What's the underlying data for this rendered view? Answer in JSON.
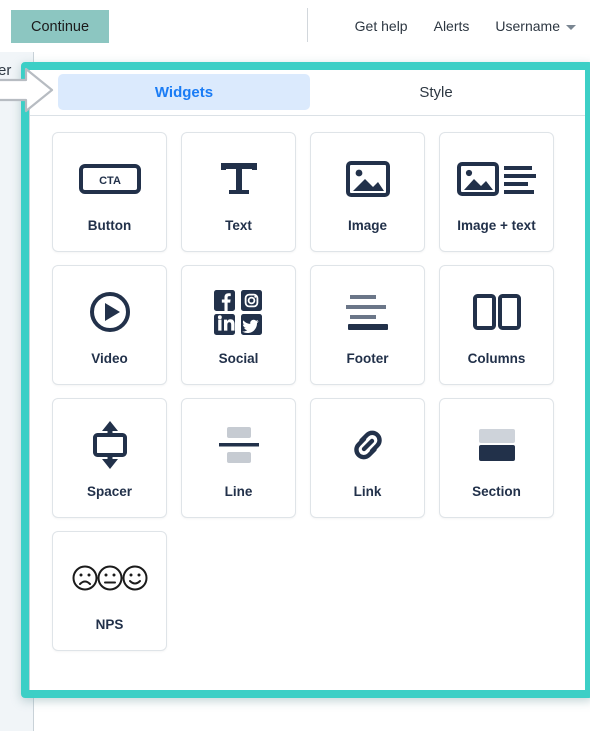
{
  "topbar": {
    "continue_label": "Continue",
    "nav_items": [
      {
        "label": "Get help",
        "name": "get-help-link"
      },
      {
        "label": "Alerts",
        "name": "alerts-link"
      },
      {
        "label": "Username",
        "name": "username-menu"
      }
    ]
  },
  "annotation": {
    "cut_off_text": "er",
    "arrow": "right-arrow-annotation"
  },
  "panel": {
    "tabs": [
      {
        "label": "Widgets",
        "active": true
      },
      {
        "label": "Style",
        "active": false
      }
    ],
    "widgets": [
      {
        "label": "Button",
        "icon": "cta-button-icon",
        "inner_text": "CTA"
      },
      {
        "label": "Text",
        "icon": "text-t-icon"
      },
      {
        "label": "Image",
        "icon": "image-icon"
      },
      {
        "label": "Image + text",
        "icon": "image-plus-text-icon"
      },
      {
        "label": "Video",
        "icon": "video-play-icon"
      },
      {
        "label": "Social",
        "icon": "social-networks-icon"
      },
      {
        "label": "Footer",
        "icon": "footer-lines-icon"
      },
      {
        "label": "Columns",
        "icon": "columns-icon"
      },
      {
        "label": "Spacer",
        "icon": "spacer-arrows-icon"
      },
      {
        "label": "Line",
        "icon": "divider-line-icon"
      },
      {
        "label": "Link",
        "icon": "chain-link-icon"
      },
      {
        "label": "Section",
        "icon": "section-blocks-icon"
      },
      {
        "label": "NPS",
        "icon": "nps-faces-icon"
      }
    ]
  },
  "colors": {
    "highlight_teal": "#3ccfc6",
    "continue_button": "#8cc6c1",
    "active_tab_bg": "#dbeafd",
    "active_tab_text": "#1a7cf5",
    "icon_navy": "#22314a",
    "page_bg": "#f1f5f8"
  }
}
